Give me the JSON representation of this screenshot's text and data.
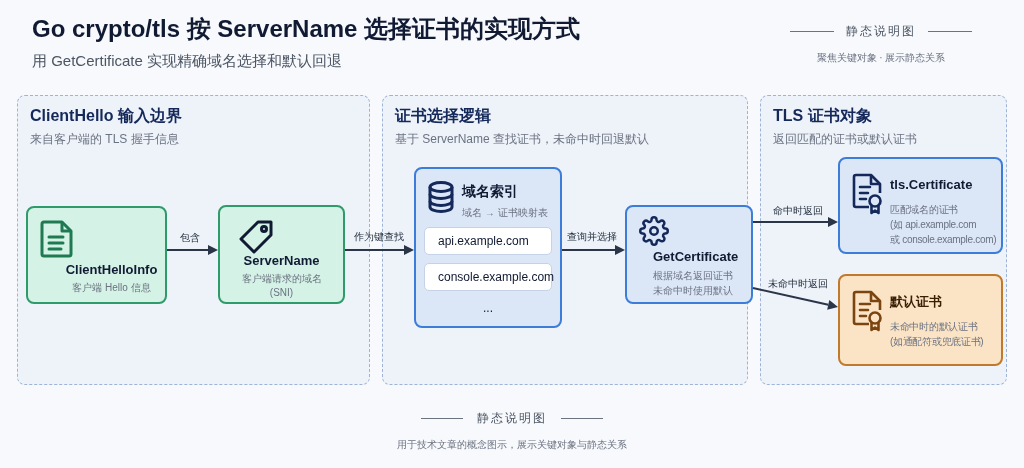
{
  "header": {
    "title": "Go crypto/tls 按 ServerName 选择证书的实现方式",
    "subtitle": "用 GetCertificate 实现精确域名选择和默认回退"
  },
  "legend": {
    "title": "静态说明图",
    "caption": "聚焦关键对象 · 展示静态关系"
  },
  "panels": [
    {
      "title": "ClientHello 输入边界",
      "subtitle": "来自客户端的 TLS 握手信息"
    },
    {
      "title": "证书选择逻辑",
      "subtitle": "基于 ServerName 查找证书，未命中时回退默认"
    },
    {
      "title": "TLS 证书对象",
      "subtitle": "返回匹配的证书或默认证书"
    }
  ],
  "nodes": [
    {
      "kind": "input",
      "title": "ClientHelloInfo",
      "lines": [
        "客户端 Hello 信息"
      ]
    },
    {
      "kind": "name",
      "title": "ServerName",
      "lines": [
        "客户端请求的域名",
        "(SNI)"
      ]
    },
    {
      "kind": "index",
      "title": "域名索引",
      "lines": [
        "域名 → 证书映射表"
      ],
      "items": [
        "api.example.com",
        "console.example.com",
        "..."
      ]
    },
    {
      "kind": "function",
      "title": "GetCertificate",
      "lines": [
        "根据域名返回证书",
        "未命中时使用默认"
      ]
    },
    {
      "kind": "certificate",
      "title": "tls.Certificate",
      "lines": [
        "匹配域名的证书",
        "(如 api.example.com",
        "或 console.example.com)"
      ]
    },
    {
      "kind": "fallback",
      "title": "默认证书",
      "lines": [
        "未命中时的默认证书",
        "(如通配符或兜底证书)"
      ]
    }
  ],
  "edges": [
    {
      "label": "包含"
    },
    {
      "label": "作为键查找"
    },
    {
      "label": "查询并选择"
    },
    {
      "label": "命中时返回"
    },
    {
      "label": "未命中时返回"
    }
  ],
  "footer": {
    "title": "静态说明图",
    "caption": "用于技术文章的概念图示，展示关键对象与静态关系"
  }
}
